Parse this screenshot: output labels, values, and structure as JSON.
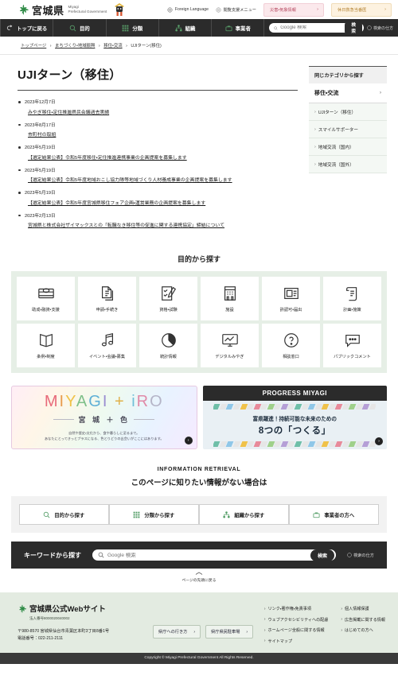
{
  "header": {
    "logo_jp": "宮城県",
    "logo_en_line1": "Miyagi",
    "logo_en_line2": "Prefectural Government",
    "foreign_language": "Foreign Language",
    "accessibility_menu": "閲覧支援メニュー",
    "disaster_label": "災害・気象情報",
    "holiday_label": "休日救急当番医",
    "chevron": "›"
  },
  "gnav": {
    "items": [
      {
        "label": "トップに戻る",
        "icon": "return-arrow-icon"
      },
      {
        "label": "目的",
        "icon": "magnifier-icon"
      },
      {
        "label": "分類",
        "icon": "grid-icon"
      },
      {
        "label": "組織",
        "icon": "org-tree-icon"
      },
      {
        "label": "事業者",
        "icon": "briefcase-icon"
      }
    ],
    "search_placeholder": "Google 検索",
    "search_button": "検索",
    "search_help": "検索の仕方"
  },
  "breadcrumb": {
    "items": [
      "トップページ",
      "まちづくり・地域振興",
      "移住・交流",
      "UJIターン(移住)"
    ],
    "separator": "›"
  },
  "page": {
    "title": "UJIターン（移住）",
    "news": [
      {
        "date": "2023年12月7日",
        "title": "みやぎ移住・定住推進県民会議過去実績"
      },
      {
        "date": "2023年8月17日",
        "title": "市町村の取組"
      },
      {
        "date": "2023年5月19日",
        "title": "【選定結果公表】令和5年度移住・定住推進連携事業の企画提案を募集します"
      },
      {
        "date": "2023年5月19日",
        "title": "【選定結果公表】令和5年度地域おこし協力隊等地域づくり人材養成事業の企画提案を募集します"
      },
      {
        "date": "2023年5月19日",
        "title": "【選定結果公表】令和5年度宮城県移住フェア企画・運営業務の企画提案を募集します"
      },
      {
        "date": "2023年2月13日",
        "title": "宮城県と株式会社ザイマックスとの「転職なき移住等の促進に関する連携協定」締結について"
      }
    ]
  },
  "sidebar": {
    "heading": "同じカテゴリから探す",
    "category": "移住・交流",
    "category_chevron": "›",
    "items": [
      {
        "label": "UJIターン（移住）"
      },
      {
        "label": "スマイルサポーター"
      },
      {
        "label": "地域交流（国内）"
      },
      {
        "label": "地域交流（国外）"
      }
    ],
    "item_chevron": "›"
  },
  "purpose": {
    "title": "目的から探す",
    "items": [
      {
        "label": "助成・融資・支援",
        "icon": "money-icon"
      },
      {
        "label": "申請・手続き",
        "icon": "documents-icon"
      },
      {
        "label": "資格・試験",
        "icon": "checklist-pen-icon"
      },
      {
        "label": "施設",
        "icon": "building-icon"
      },
      {
        "label": "許認可・届出",
        "icon": "stamp-doc-icon"
      },
      {
        "label": "計画・施策",
        "icon": "scroll-icon"
      },
      {
        "label": "条例・制度",
        "icon": "open-book-icon"
      },
      {
        "label": "イベント・会議・募集",
        "icon": "music-note-icon"
      },
      {
        "label": "統計情報",
        "icon": "pie-chart-icon"
      },
      {
        "label": "デジタルみやぎ",
        "icon": "monitor-chart-icon"
      },
      {
        "label": "相談窓口",
        "icon": "question-circle-icon"
      },
      {
        "label": "パブリックコメント",
        "icon": "speech-bubble-icon"
      }
    ]
  },
  "banners": {
    "iro": {
      "logo_letters": [
        "M",
        "I",
        "Y",
        "A",
        "G",
        "I",
        "+",
        "i",
        "R",
        "O"
      ],
      "subtitle": "宮 城 ＋ 色",
      "tagline_line1": "自然や歴史・文化から、食や暮らしに至るまで。",
      "tagline_line2": "あなたにとってきっとプラスになる、色とりどりの出会いがここにはあります。",
      "chevron": "›"
    },
    "progress": {
      "heading": "PROGRESS MIYAGI",
      "line1": "富県躍進！持続可能な未来のための",
      "line2": "8つの「つくる」",
      "chevron": "›"
    }
  },
  "info_retrieval": {
    "heading_en": "INFORMATION RETRIEVAL",
    "heading_jp": "このページに知りたい情報がない場合は",
    "buttons": [
      {
        "label": "目的から探す",
        "icon": "magnifier-icon"
      },
      {
        "label": "分類から探す",
        "icon": "grid-icon"
      },
      {
        "label": "組織から探す",
        "icon": "org-tree-icon"
      },
      {
        "label": "事業者の方へ",
        "icon": "briefcase-icon"
      }
    ]
  },
  "keyword_search": {
    "label": "キーワードから探す",
    "placeholder": "Google 検索",
    "button": "検索",
    "help": "検索の仕方"
  },
  "to_top": {
    "caret": "︿",
    "label": "ページの先頭に戻る"
  },
  "footer": {
    "brand": "宮城県公式Webサイト",
    "corporate_number": "法人番号8000020040002",
    "address": "〒980-8570 宮城県仙台市青葉区本町3丁目8番1号",
    "phone": "電話番号：022-211-2111",
    "pills": [
      {
        "label": "県庁への行き方",
        "chevron": "›"
      },
      {
        "label": "県庁県民駐車場",
        "chevron": "›"
      }
    ],
    "links_col1": [
      "リンク・著作権・免責事項",
      "ウェブアクセシビリティへの配慮",
      "ホームページ全般に関する情報",
      "サイトマップ"
    ],
    "links_col2": [
      "個人情報保護",
      "広告掲載に関する情報",
      "はじめての方へ"
    ],
    "link_chevron": "›",
    "copyright": "Copyright © Miyagi Prefectural Government All Rights Reserved."
  },
  "colors": {
    "brand_green": "#4f9b63",
    "dark_bar": "#2b2b2b",
    "footer_bg": "#e3ebe1",
    "purpose_bg": "#e6efe6"
  }
}
